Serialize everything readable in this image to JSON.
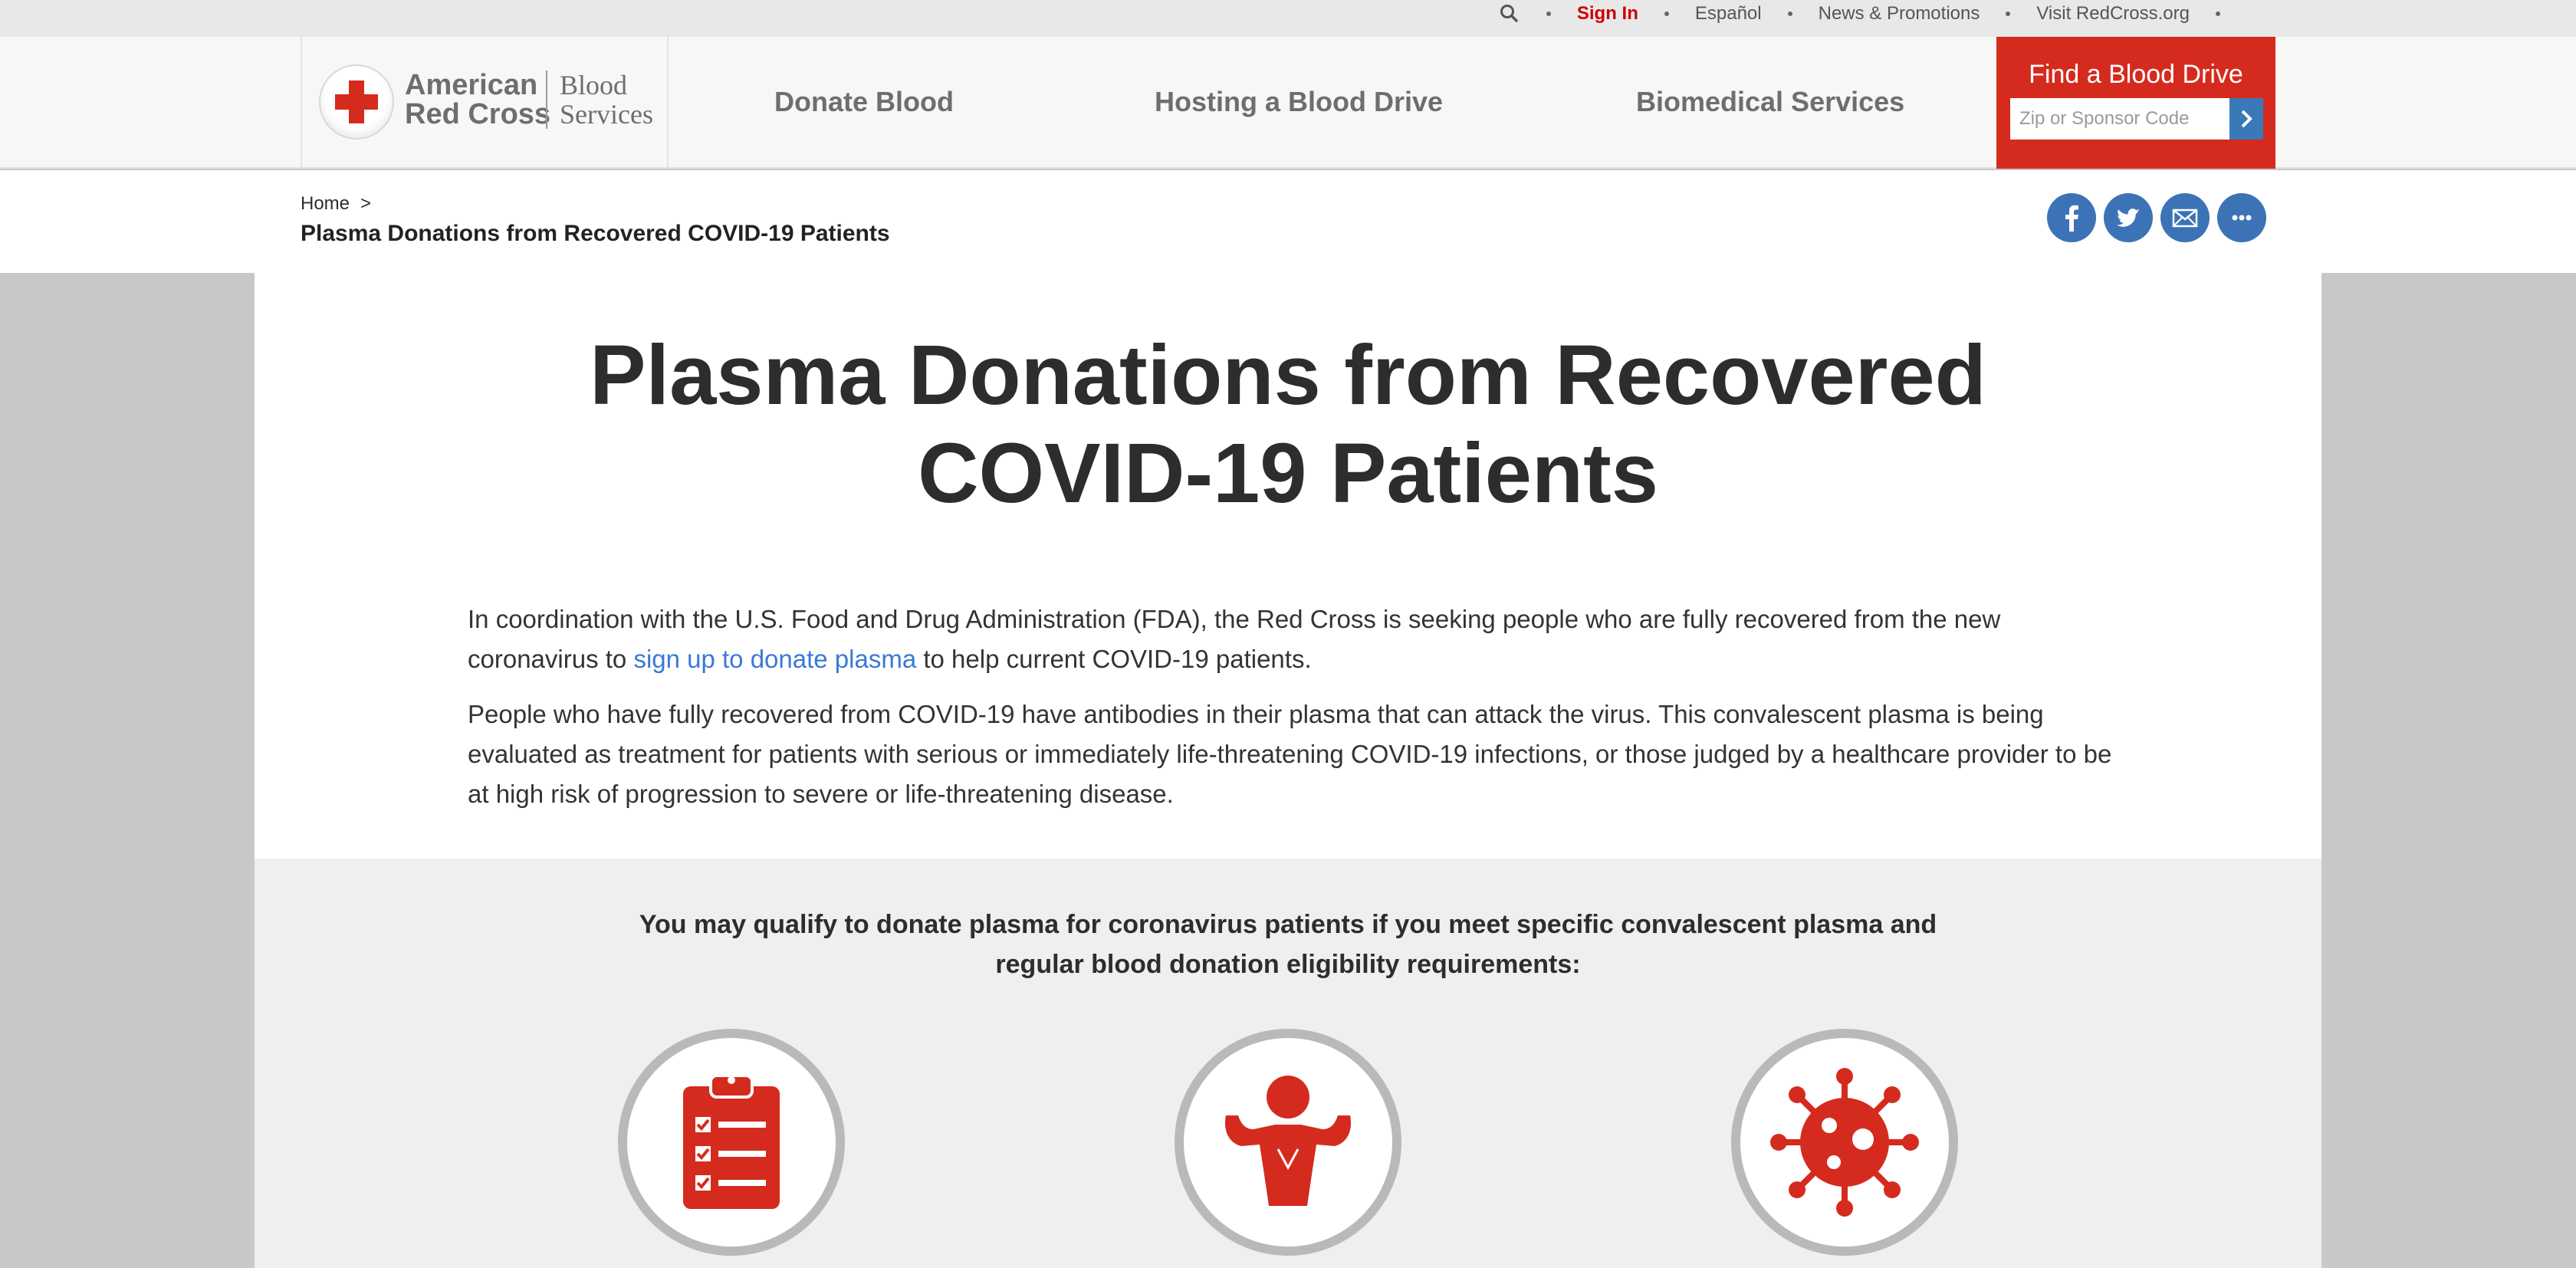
{
  "utility": {
    "sign_in": "Sign In",
    "espanol": "Español",
    "news": "News & Promotions",
    "visit": "Visit RedCross.org"
  },
  "logo": {
    "org_line1": "American",
    "org_line2": "Red Cross",
    "sub_line1": "Blood",
    "sub_line2": "Services"
  },
  "nav": {
    "donate": "Donate Blood",
    "hosting": "Hosting a Blood Drive",
    "biomedical": "Biomedical Services"
  },
  "find_drive": {
    "title": "Find a Blood Drive",
    "placeholder": "Zip or Sponsor Code"
  },
  "breadcrumb": {
    "home": "Home",
    "separator": ">",
    "current": "Plasma Donations from Recovered COVID-19 Patients"
  },
  "share": [
    "facebook-icon",
    "twitter-icon",
    "email-icon",
    "more-icon"
  ],
  "page": {
    "title_line1": "Plasma Donations from Recovered",
    "title_line2": "COVID-19 Patients",
    "p1_before": "In coordination with the U.S. Food and Drug Administration (FDA), the Red Cross is seeking people who are fully recovered from the new coronavirus to ",
    "p1_link": "sign up to donate plasma",
    "p1_after": " to help current COVID-19 patients.",
    "p2": "People who have fully recovered from COVID-19 have antibodies in their plasma that can attack the virus. This convalescent plasma is being evaluated as treatment for patients with serious or immediately life-threatening COVID-19 infections, or those judged by a healthcare provider to be at high risk of progression to severe or life-threatening disease."
  },
  "eligibility": {
    "heading_line1": "You may qualify to donate plasma for coronavirus patients if you meet specific convalescent plasma and",
    "heading_line2": "regular blood donation eligibility requirements:",
    "icons": [
      "clipboard-checklist-icon",
      "strong-person-icon",
      "virus-icon"
    ]
  },
  "colors": {
    "brand_red": "#d52b1e",
    "link_blue": "#3a79d6",
    "social_blue": "#3c73b6",
    "text_dark": "#2d2d2d"
  }
}
